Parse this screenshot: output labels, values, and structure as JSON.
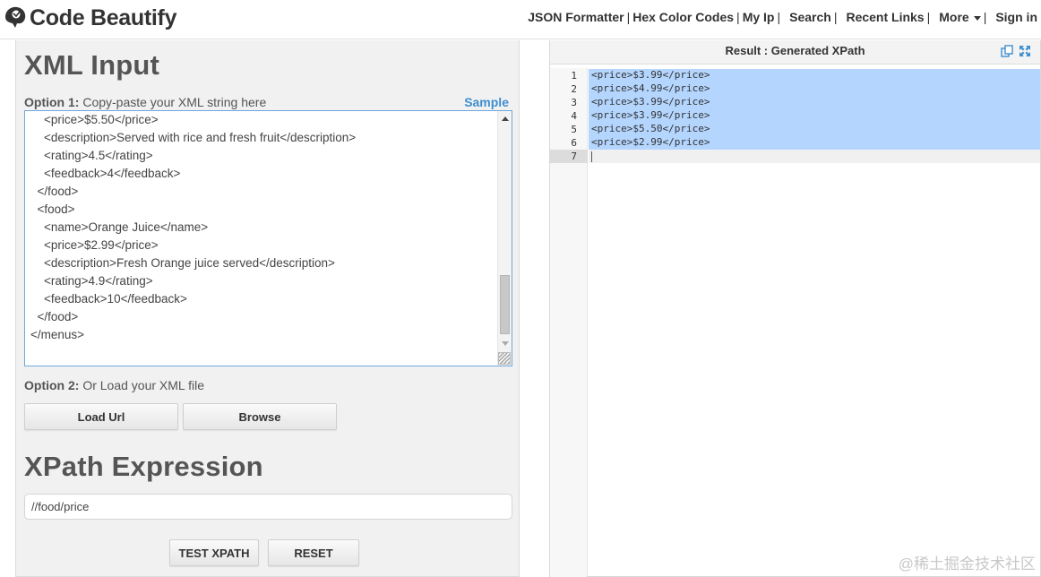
{
  "header": {
    "logo_text": "Code Beautify",
    "nav": [
      {
        "label": "JSON Formatter"
      },
      {
        "label": "Hex Color Codes"
      },
      {
        "label": "My Ip"
      },
      {
        "label": "Search"
      },
      {
        "label": "Recent Links"
      },
      {
        "label": "More"
      },
      {
        "label": "Sign in"
      }
    ],
    "separator": "|"
  },
  "left": {
    "xml_title": "XML Input",
    "option1_bold": "Option 1:",
    "option1_text": " Copy-paste your XML string here",
    "sample_label": "Sample",
    "xml_lines": [
      "    <price>$5.50</price>",
      "    <description>Served with rice and fresh fruit</description>",
      "    <rating>4.5</rating>",
      "    <feedback>4</feedback>",
      "  </food>",
      "  <food>",
      "    <name>Orange Juice</name>",
      "    <price>$2.99</price>",
      "    <description>Fresh Orange juice served</description>",
      "    <rating>4.9</rating>",
      "    <feedback>10</feedback>",
      "  </food>",
      "</menus>"
    ],
    "option2_bold": "Option 2:",
    "option2_text": " Or Load your XML file",
    "load_url_label": "Load Url",
    "browse_label": "Browse",
    "xpath_title": "XPath Expression",
    "xpath_value": "//food/price",
    "test_label": "TEST XPATH",
    "reset_label": "RESET"
  },
  "right": {
    "result_title": "Result : Generated XPath",
    "line_numbers": [
      "1",
      "2",
      "3",
      "4",
      "5",
      "6",
      "7"
    ],
    "result_lines": [
      "<price>$3.99</price>",
      "<price>$4.99</price>",
      "<price>$3.99</price>",
      "<price>$3.99</price>",
      "<price>$5.50</price>",
      "<price>$2.99</price>",
      ""
    ],
    "selection_color": "#b4d5fe"
  },
  "watermark": "@稀土掘金技术社区",
  "colors": {
    "accent": "#3e8ed0",
    "panel_bg": "#f1f1f1",
    "input_border": "#6fa8dc"
  }
}
